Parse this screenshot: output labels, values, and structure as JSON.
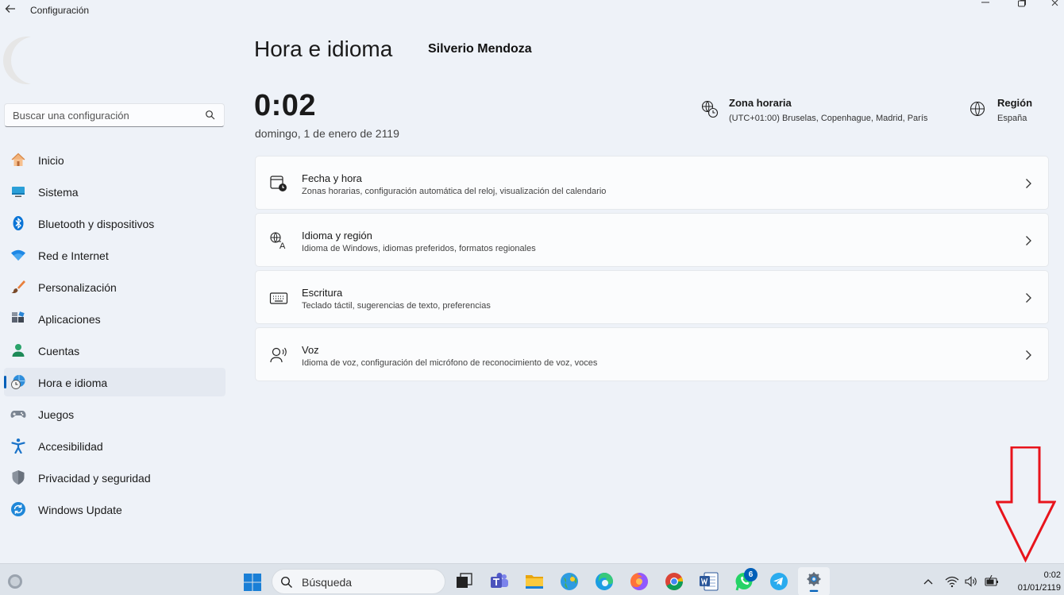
{
  "window": {
    "title": "Configuración"
  },
  "sidebar": {
    "search_placeholder": "Buscar una configuración",
    "items": [
      {
        "label": "Inicio",
        "icon": "home-icon"
      },
      {
        "label": "Sistema",
        "icon": "monitor-icon"
      },
      {
        "label": "Bluetooth y dispositivos",
        "icon": "bluetooth-icon"
      },
      {
        "label": "Red e Internet",
        "icon": "wifi-icon"
      },
      {
        "label": "Personalización",
        "icon": "brush-icon"
      },
      {
        "label": "Aplicaciones",
        "icon": "apps-icon"
      },
      {
        "label": "Cuentas",
        "icon": "person-icon"
      },
      {
        "label": "Hora e idioma",
        "icon": "clock-globe-icon",
        "active": true
      },
      {
        "label": "Juegos",
        "icon": "gamepad-icon"
      },
      {
        "label": "Accesibilidad",
        "icon": "accessibility-icon"
      },
      {
        "label": "Privacidad y seguridad",
        "icon": "shield-icon"
      },
      {
        "label": "Windows Update",
        "icon": "update-icon"
      }
    ]
  },
  "main": {
    "title": "Hora e idioma",
    "user_name": "Silverio Mendoza",
    "time": "0:02",
    "date": "domingo, 1 de enero de 2119",
    "timezone": {
      "label": "Zona horaria",
      "value": "(UTC+01:00) Bruselas, Copenhague, Madrid, París"
    },
    "region": {
      "label": "Región",
      "value": "España"
    },
    "cards": [
      {
        "title": "Fecha y hora",
        "subtitle": "Zonas horarias, configuración automática del reloj, visualización del calendario",
        "icon": "calendar-clock-icon"
      },
      {
        "title": "Idioma y región",
        "subtitle": "Idioma de Windows, idiomas preferidos, formatos regionales",
        "icon": "language-icon"
      },
      {
        "title": "Escritura",
        "subtitle": "Teclado táctil, sugerencias de texto, preferencias",
        "icon": "keyboard-icon"
      },
      {
        "title": "Voz",
        "subtitle": "Idioma de voz, configuración del micrófono de reconocimiento de voz, voces",
        "icon": "speech-icon"
      }
    ]
  },
  "taskbar": {
    "search_label": "Búsqueda",
    "whatsapp_badge": "6",
    "tray_time": "0:02",
    "tray_date": "01/01/2119"
  },
  "colors": {
    "accent": "#005fb8",
    "arrow": "#e8141c"
  }
}
